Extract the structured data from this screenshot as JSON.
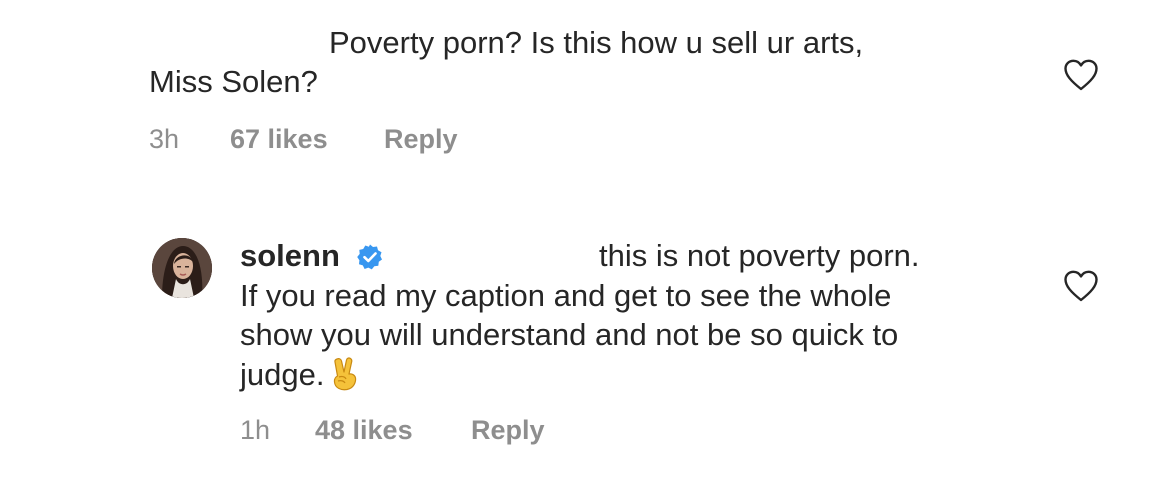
{
  "comments": [
    {
      "text_line1": "Poverty porn? Is this how u sell ur arts,",
      "text_line2": "Miss Solen?",
      "time": "3h",
      "likes": "67 likes",
      "reply_label": "Reply",
      "like_icon": "heart-outline-icon"
    },
    {
      "username": "solenn",
      "verified_icon": "verified-badge-icon",
      "text_line1": "this is not poverty porn.",
      "text_line2": "If you read my caption and get to see the whole",
      "text_line3": "show you will understand and not be so quick to",
      "text_line4": "judge.",
      "emoji_icon": "victory-hand-emoji-icon",
      "time": "1h",
      "likes": "48 likes",
      "reply_label": "Reply",
      "like_icon": "heart-outline-icon"
    }
  ],
  "colors": {
    "text": "#262626",
    "secondary": "#8e8e8e",
    "verified": "#3897f0",
    "emoji": "#f5c23a"
  }
}
